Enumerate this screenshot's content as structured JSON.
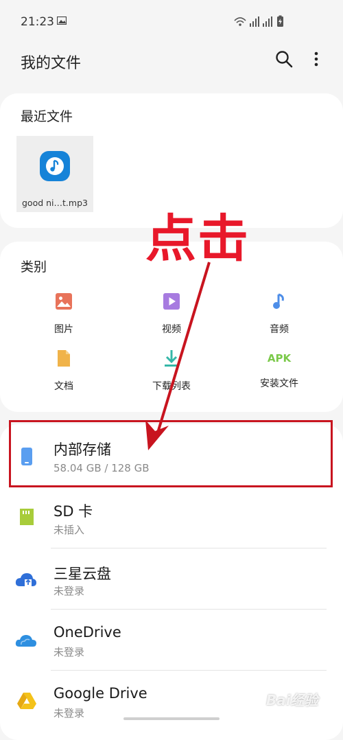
{
  "status_bar": {
    "time": "21:23"
  },
  "app_bar": {
    "title": "我的文件"
  },
  "recent": {
    "title": "最近文件",
    "files": [
      {
        "name": "good ni…t.mp3"
      }
    ]
  },
  "categories": {
    "title": "类别",
    "items": [
      {
        "label": "图片",
        "icon": "image-icon",
        "color": "#e8735a"
      },
      {
        "label": "视频",
        "icon": "video-icon",
        "color": "#a77be0"
      },
      {
        "label": "音频",
        "icon": "audio-icon",
        "color": "#4e8ee8"
      },
      {
        "label": "文档",
        "icon": "document-icon",
        "color": "#f0b34a"
      },
      {
        "label": "下载列表",
        "icon": "download-icon",
        "color": "#35b7a8"
      },
      {
        "label": "安装文件",
        "icon": "apk-icon",
        "icon_text": "APK",
        "color": "#7bc94a"
      }
    ]
  },
  "storage": [
    {
      "name": "内部存储",
      "detail": "58.04 GB / 128 GB",
      "icon": "phone-icon",
      "color": "#5a9ef0"
    },
    {
      "name": "SD 卡",
      "detail": "未插入",
      "icon": "sd-card-icon",
      "color": "#a8cc3a"
    },
    {
      "name": "三星云盘",
      "detail": "未登录",
      "icon": "samsung-cloud-icon",
      "color": "#2f6fd8"
    },
    {
      "name": "OneDrive",
      "detail": "未登录",
      "icon": "onedrive-icon",
      "color": "#2e8fe0"
    },
    {
      "name": "Google Drive",
      "detail": "未登录",
      "icon": "google-drive-icon",
      "color": "#f4c21a"
    }
  ],
  "annotation": {
    "text": "点击",
    "color": "#e8182a"
  },
  "watermark": {
    "text": "Bai经验"
  }
}
